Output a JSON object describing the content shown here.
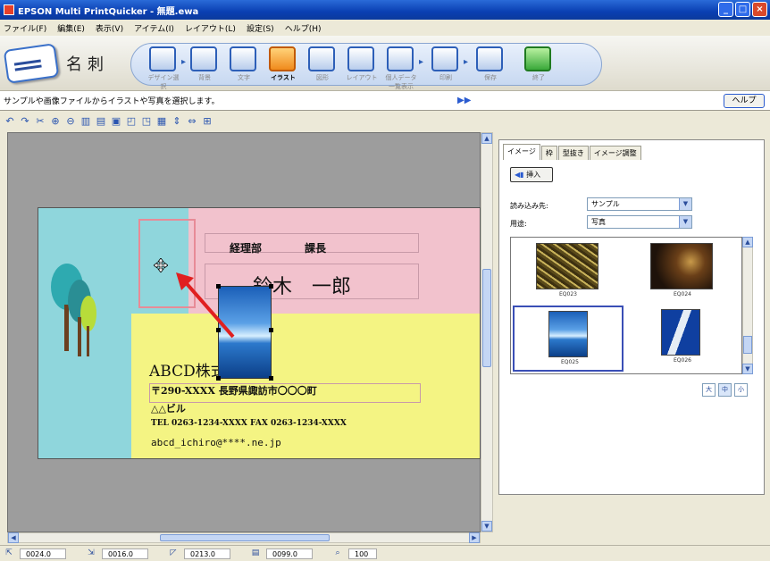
{
  "window": {
    "title": "EPSON Multi PrintQuicker - 無題.ewa",
    "minimize": "_",
    "maximize": "□",
    "close": "×"
  },
  "menu": [
    "ファイル(F)",
    "編集(E)",
    "表示(V)",
    "アイテム(I)",
    "レイアウト(L)",
    "設定(S)",
    "ヘルプ(H)"
  ],
  "mode": {
    "label": "名刺"
  },
  "steps": [
    {
      "label": "デザイン選択",
      "active": false
    },
    {
      "label": "背景",
      "active": false
    },
    {
      "label": "文字",
      "active": false
    },
    {
      "label": "イラスト",
      "active": true
    },
    {
      "label": "図形",
      "active": false
    },
    {
      "label": "レイアウト",
      "active": false
    },
    {
      "label": "個人データ一覧表示",
      "active": false
    },
    {
      "label": "印刷",
      "active": false
    },
    {
      "label": "保存",
      "active": false
    },
    {
      "label": "終了",
      "active": false
    }
  ],
  "status_message": "サンプルや画像ファイルからイラストや写真を選択します。",
  "help_label": "ヘルプ",
  "card": {
    "dept": "経理部",
    "position": "課長",
    "name": "鈴木　一郎",
    "company": "ABCD株式会社",
    "address": "〒290-XXXX 長野県諏訪市〇〇〇町",
    "building": "△△ビル",
    "tel_fax": "TEL 0263-1234-XXXX FAX 0263-1234-XXXX",
    "email": "abcd_ichiro@****.ne.jp"
  },
  "panel": {
    "tabs": [
      "イメージ",
      "枠",
      "型抜き",
      "イメージ調整"
    ],
    "insert_label": "挿入",
    "source_label": "読み込み先:",
    "source_value": "サンプル",
    "usage_label": "用途:",
    "usage_value": "写真",
    "thumbnails": [
      {
        "name": "EQ023",
        "selected": false
      },
      {
        "name": "EQ024",
        "selected": false
      },
      {
        "name": "EQ025",
        "selected": true
      },
      {
        "name": "EQ026",
        "selected": false
      }
    ],
    "view_buttons": [
      "大",
      "中",
      "小"
    ]
  },
  "statusbar": {
    "x": "0024.0",
    "y": "0016.0",
    "w": "0213.0",
    "h": "0099.0",
    "zoom": "100"
  },
  "colors": {
    "card_cyan": "#8fd6dc",
    "card_pink": "#f2c2cd",
    "card_yellow": "#f4f483",
    "selection_outline": "#3a4fb6",
    "drag_arrow": "#e02020"
  }
}
